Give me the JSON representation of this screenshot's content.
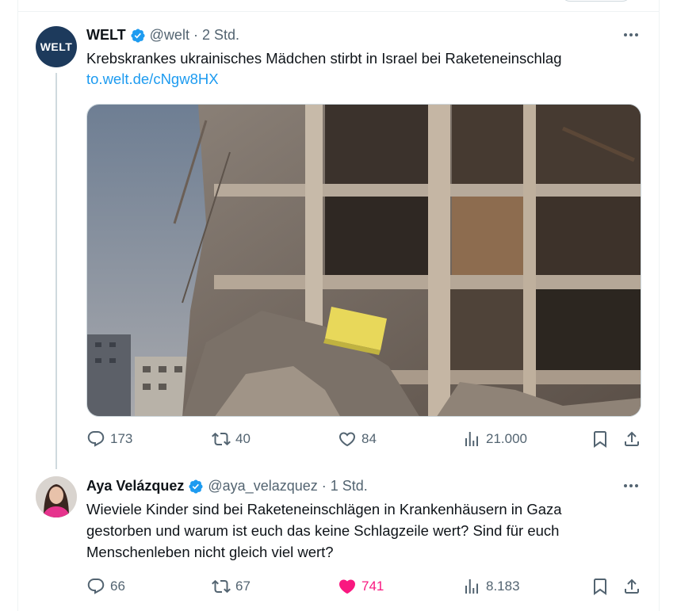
{
  "tweets": [
    {
      "avatar_text": "WELT",
      "name": "WELT",
      "handle": "@welt",
      "separator": "·",
      "time": "2 Std.",
      "text": "Krebskrankes ukrainisches Mädchen stirbt in Israel bei Raketeneinschlag",
      "link": "to.welt.de/cNgw8HX",
      "media_icon": "destroyed-building-photo",
      "stats": {
        "replies": "173",
        "retweets": "40",
        "likes": "84",
        "views": "21.000"
      }
    },
    {
      "name": "Aya Velázquez",
      "handle": "@aya_velazquez",
      "separator": "·",
      "time": "1 Std.",
      "text_lines": [
        "Wieviele Kinder sind bei Raketeneinschlägen in Krankenhäusern in Gaza",
        "gestorben und warum ist euch das keine Schlagzeile wert? Sind für euch",
        "Menschenleben nicht gleich viel wert?"
      ],
      "stats": {
        "replies": "66",
        "retweets": "67",
        "likes": "741",
        "views": "8.183"
      }
    }
  ],
  "colors": {
    "link": "#1d9bf0",
    "verified": "#1d9bf0",
    "like_active": "#f91880",
    "muted": "#536471",
    "border": "#cfd9de"
  }
}
